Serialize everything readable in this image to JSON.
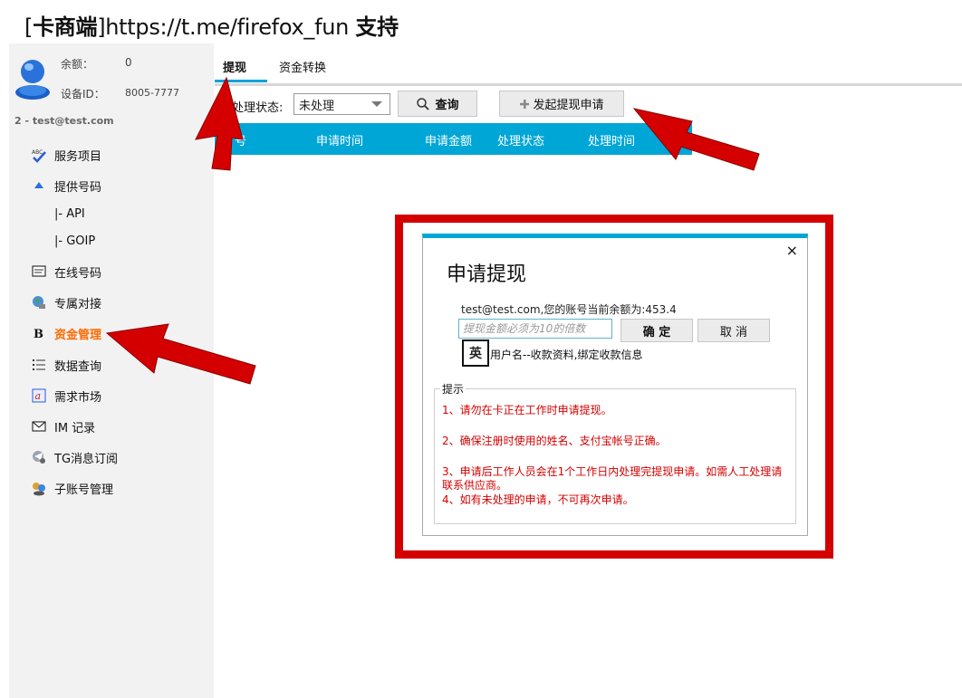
{
  "window_title": {
    "part1": "[",
    "part2": "卡商端",
    "part3": "]https://t.me/firefox_fun ",
    "part4": "支持"
  },
  "sidebar": {
    "balance_label": "余额：",
    "balance_value": "0",
    "device_label": "设备ID：",
    "device_value": "8005-7777",
    "account": "2 - test@test.com",
    "items": [
      {
        "label": "服务项目",
        "icon": "abc-check-icon"
      },
      {
        "label": "提供号码",
        "icon": "up-triangle-icon"
      },
      {
        "label": "|-  API",
        "icon": ""
      },
      {
        "label": "|-  GOIP",
        "icon": ""
      },
      {
        "label": "在线号码",
        "icon": "card-icon"
      },
      {
        "label": "专属对接",
        "icon": "globe-icon"
      },
      {
        "label": "资金管理",
        "icon": "bold-b-icon"
      },
      {
        "label": "数据查询",
        "icon": "list-icon"
      },
      {
        "label": "需求市场",
        "icon": "letter-a-icon"
      },
      {
        "label": "IM 记录",
        "icon": "envelope-icon"
      },
      {
        "label": "TG消息订阅",
        "icon": "telegram-icon"
      },
      {
        "label": "子账号管理",
        "icon": "users-icon"
      }
    ]
  },
  "tabs": [
    {
      "label": "提现",
      "active": true
    },
    {
      "label": "资金转换",
      "active": false
    }
  ],
  "toolbar": {
    "status_label": "处理状态:",
    "status_value": "未处理",
    "query_label": "查询",
    "apply_label": "发起提现申请"
  },
  "table": {
    "columns": [
      "号",
      "申请时间",
      "申请金额",
      "处理状态",
      "处理时间"
    ]
  },
  "dialog": {
    "title": "申请提现",
    "close": "×",
    "balance_text": "test@test.com,您的账号当前余额为:453.4",
    "amount_placeholder": "提现金额必须为10的倍数",
    "ok_label": "确 定",
    "cancel_label": "取 消",
    "ime": "英",
    "bind_text": "用户名--收款资料,绑定收款信息",
    "tips_title": "提示",
    "tips": [
      "1、请勿在卡正在工作时申请提现。",
      "2、确保注册时使用的姓名、支付宝帐号正确。",
      "3、申请后工作人员会在1个工作日内处理完提现申请。如需人工处理请联系供应商。",
      "4、如有未处理的申请，不可再次申请。"
    ]
  },
  "colors": {
    "accent": "#00a6d6",
    "active_nav": "#ff6a00",
    "annotation_red": "#d40000"
  }
}
